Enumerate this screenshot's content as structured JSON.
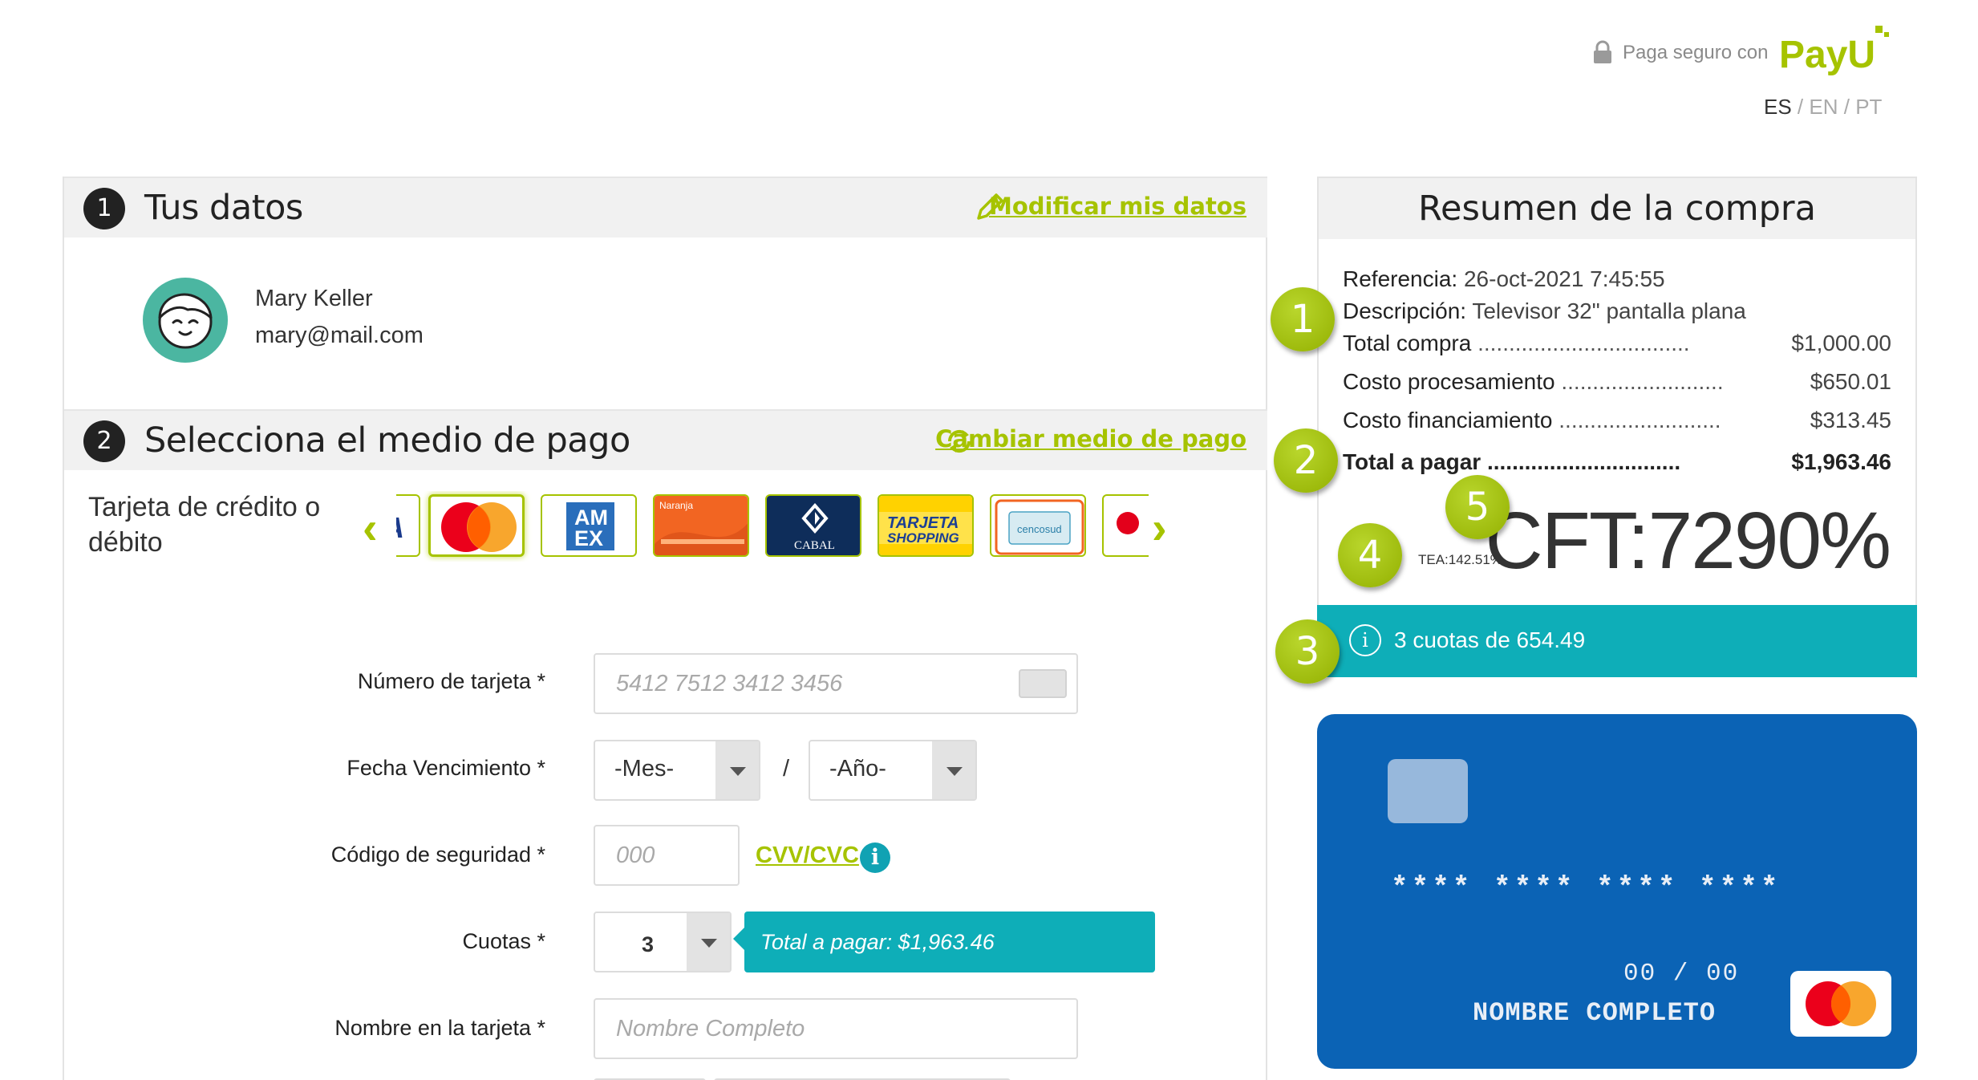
{
  "header": {
    "secure_text": "Paga seguro con",
    "brand": "PayU",
    "languages": [
      "ES",
      "EN",
      "PT"
    ],
    "active_language": "ES"
  },
  "section1": {
    "number": "1",
    "title": "Tus datos",
    "link": "Modificar mis datos",
    "user_name": "Mary Keller",
    "user_email": "mary@mail.com"
  },
  "section2": {
    "number": "2",
    "title": "Selecciona el medio de pago",
    "link": "Cambiar medio de pago",
    "method_label": "Tarjeta de crédito o débito",
    "card_brands": [
      "VISA",
      "Mastercard",
      "American Express",
      "Naranja",
      "Cabal",
      "Tarjeta Shopping",
      "Cencosud",
      "Otra"
    ],
    "selected_brand": "Mastercard",
    "cabal_text": "CABAL",
    "shopping_text": [
      "TARJETA",
      "SHOPPING"
    ],
    "amex_text": [
      "AM",
      "EX"
    ],
    "naranja_text": "Naranja",
    "cencosud_text": "cencosud",
    "visa_text": "VISA"
  },
  "form": {
    "card_number_label": "Número de tarjeta *",
    "card_number_placeholder": "5412 7512 3412 3456",
    "expiry_label": "Fecha Vencimiento *",
    "month_value": "-Mes-",
    "year_value": "-Año-",
    "expiry_separator": "/",
    "cvv_label": "Código de seguridad *",
    "cvv_placeholder": "000",
    "cvv_link": "CVV/CVC",
    "cuotas_label": "Cuotas *",
    "cuotas_value": "3",
    "cuotas_tooltip": "Total a pagar: $1,963.46",
    "name_label": "Nombre en la tarjeta *",
    "name_placeholder": "Nombre Completo"
  },
  "summary": {
    "title": "Resumen de la compra",
    "referencia_label": "Referencia:",
    "referencia_value": "26-oct-2021 7:45:55",
    "descripcion_label": "Descripción:",
    "descripcion_value": "Televisor 32\" pantalla plana",
    "rows": [
      {
        "label": "Total compra",
        "amount": "$1,000.00"
      },
      {
        "label": "Costo procesamiento",
        "amount": "$650.01"
      },
      {
        "label": "Costo financiamiento",
        "amount": "$313.45"
      }
    ],
    "total_label": "Total a pagar",
    "total_amount": "$1,963.46",
    "tea": "TEA:142.51%",
    "cft": "CFT:7290%",
    "cuotas_text": "3 cuotas de 654.49"
  },
  "badges": [
    "1",
    "2",
    "3",
    "4",
    "5"
  ],
  "card_preview": {
    "number": "**** **** **** ****",
    "expiry": "00 / 00",
    "holder": "NOMBRE COMPLETO"
  },
  "colors": {
    "accent_green": "#a6c300",
    "teal": "#0eaeb8",
    "card_blue": "#0b63b5",
    "header_gray": "#f1f1f1"
  },
  "icons": {
    "lock": "lock-icon",
    "pencil": "pencil-icon",
    "refresh": "refresh-icon",
    "info": "info-icon",
    "arrow_left": "chevron-left-icon",
    "arrow_right": "chevron-right-icon"
  }
}
